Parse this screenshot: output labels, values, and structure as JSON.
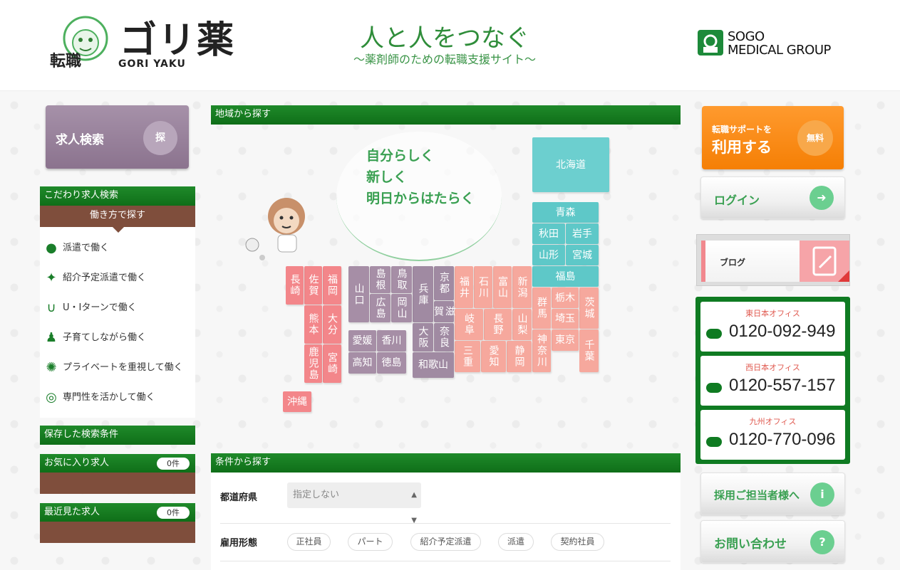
{
  "header": {
    "logo_jp": "ゴリ薬",
    "logo_badge": "転職",
    "logo_en": "GORI YAKU",
    "tagline": "人と人をつなぐ",
    "subtagline": "〜薬剤師のための転職支援サイト〜",
    "group_line1": "SOGO",
    "group_line2": "MEDICAL GROUP"
  },
  "sidebar": {
    "search_label": "求人検索",
    "search_circle": "探",
    "kodawari_title": "こだわり求人検索",
    "kodawari_sub": "働き方で探す",
    "items": [
      {
        "label": "派遣で働く",
        "icon": "person-icon"
      },
      {
        "label": "紹介予定派遣で働く",
        "icon": "handshake-icon"
      },
      {
        "label": "U・Iターンで働く",
        "icon": "u-turn-icon"
      },
      {
        "label": "子育てしながら働く",
        "icon": "parent-child-icon"
      },
      {
        "label": "プライベートを重視して働く",
        "icon": "sparkle-icon"
      },
      {
        "label": "専門性を活かして働く",
        "icon": "target-icon"
      }
    ],
    "saved_title": "保存した検索条件",
    "favorites_title": "お気に入り求人",
    "favorites_count": "0件",
    "recent_title": "最近見た求人",
    "recent_count": "0件"
  },
  "main": {
    "region_title": "地域から探す",
    "bubble_lines": [
      "自分らしく",
      "新しく",
      "明日からはたらく"
    ],
    "prefectures": {
      "hokkaido": "北海道",
      "aomori": "青森",
      "akita": "秋田",
      "iwate": "岩手",
      "yamagata": "山形",
      "miyagi": "宮城",
      "fukushima": "福島",
      "ibaraki": "茨城",
      "tochigi": "栃木",
      "gunma": "群馬",
      "saitama": "埼玉",
      "chiba": "千葉",
      "tokyo": "東京",
      "kanagawa": "神奈川",
      "niigata": "新潟",
      "toyama": "富山",
      "ishikawa": "石川",
      "fukui": "福井",
      "yamanashi": "山梨",
      "nagano": "長野",
      "gifu": "岐阜",
      "shizuoka": "静岡",
      "aichi": "愛知",
      "mie": "三重",
      "shiga": "滋賀",
      "kyoto": "京都",
      "osaka": "大阪",
      "hyogo": "兵庫",
      "nara": "奈良",
      "wakayama": "和歌山",
      "tottori": "鳥取",
      "shimane": "島根",
      "okayama": "岡山",
      "hiroshima": "広島",
      "yamaguchi": "山口",
      "tokushima": "徳島",
      "kagawa": "香川",
      "ehime": "愛媛",
      "kochi": "高知",
      "fukuoka": "福岡",
      "saga": "佐賀",
      "nagasaki": "長崎",
      "kumamoto": "熊本",
      "oita": "大分",
      "miyazaki": "宮崎",
      "kagoshima": "鹿児島",
      "okinawa": "沖縄"
    },
    "condition_title": "条件から探す",
    "pref_label": "都道府県",
    "pref_value": "指定しない",
    "employment_label": "雇用形態",
    "employment_options": [
      "正社員",
      "パート",
      "紹介予定派遣",
      "派遣",
      "契約社員"
    ]
  },
  "right": {
    "support_line1": "転職サポートを",
    "support_line2": "利用する",
    "support_badge": "無料",
    "login_label": "ログイン",
    "blog_label": "ブログ",
    "offices": [
      {
        "name": "東日本オフィス",
        "phone": "0120-092-949"
      },
      {
        "name": "西日本オフィス",
        "phone": "0120-557-157"
      },
      {
        "name": "九州オフィス",
        "phone": "0120-770-096"
      }
    ],
    "recruit_label": "採用ご担当者様へ",
    "recruit_icon": "i",
    "contact_label": "お問い合わせ",
    "contact_icon": "?"
  },
  "colors": {
    "brand_green": "#0f6e18",
    "brown": "#7f4e3c",
    "kyushu": "#f3868a",
    "chugoku": "#a68ea6",
    "chubu": "#f6a89d",
    "tohoku": "#5ec8c8",
    "orange": "#f57f05"
  }
}
